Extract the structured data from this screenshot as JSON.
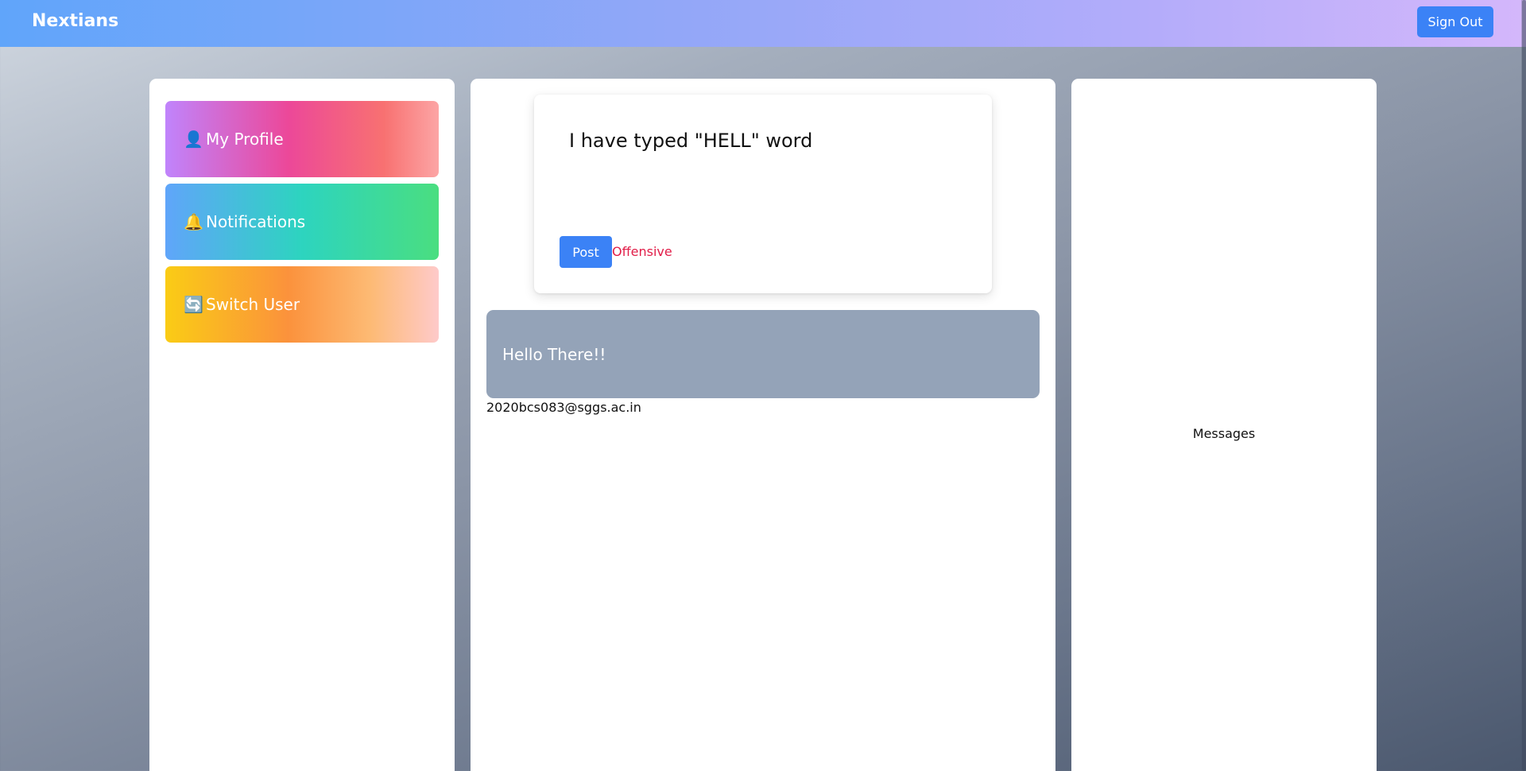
{
  "header": {
    "brand": "Nextians",
    "sign_out_label": "Sign Out"
  },
  "sidebar": {
    "items": [
      {
        "icon": "user-icon",
        "glyph": "👤",
        "label": "My Profile"
      },
      {
        "icon": "bell-icon",
        "glyph": "🔔",
        "label": "Notifications"
      },
      {
        "icon": "switch-icon",
        "glyph": "🔄",
        "label": "Switch User"
      }
    ]
  },
  "compose": {
    "text": "I have typed \"HELL\" word",
    "post_label": "Post",
    "warning": "Offensive"
  },
  "feed": {
    "posts": [
      {
        "text": "Hello There!!",
        "author": "2020bcs083@sggs.ac.in"
      }
    ]
  },
  "messages": {
    "label": "Messages"
  },
  "colors": {
    "accent": "#3b82f6",
    "warning": "#e11d48",
    "post_card": "#94a3b8"
  }
}
